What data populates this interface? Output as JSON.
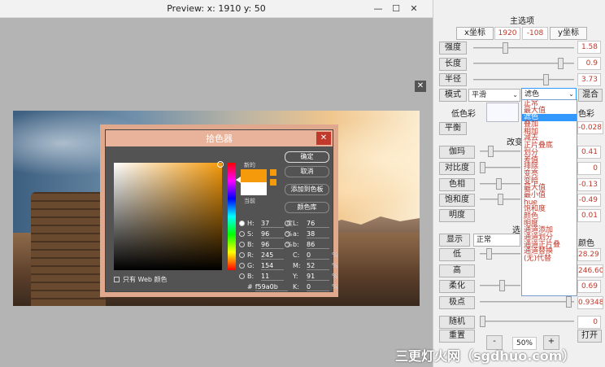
{
  "preview": {
    "title": "Preview:  x: 1910 y: 50",
    "minimize": "—",
    "maximize": "☐",
    "close": "✕",
    "image_close": "✕"
  },
  "picker": {
    "title": "拾色器",
    "close": "✕",
    "new_label": "新的",
    "current_label": "当前",
    "btn_ok": "确定",
    "btn_cancel": "取消",
    "btn_add_swatch": "添加到色板",
    "btn_library": "颜色库",
    "H": "37",
    "H_unit": "度",
    "S": "96",
    "S_unit": "%",
    "Bv": "96",
    "B_unit": "%",
    "R": "245",
    "G": "154",
    "Bc": "11",
    "L": "76",
    "a": "38",
    "b": "86",
    "C": "0",
    "M": "52",
    "Y": "91",
    "K": "0",
    "hex_label": "#",
    "hex": "f59a0b",
    "web_only": "只有 Web 颜色"
  },
  "panel": {
    "title": "主选项",
    "x_tab": "x坐标",
    "x_val": "1920",
    "neg_val": "-108",
    "y_tab": "y坐标",
    "strength_label": "强度",
    "strength_val": "1.58",
    "length_label": "长度",
    "length_val": "0.9",
    "radius_label": "半径",
    "radius_val": "3.73",
    "mode_label": "模式",
    "mode_val": "平滑",
    "filter_val": "滤色",
    "blend_btn": "混合",
    "lowcolor_label": "低色彩",
    "lowcolor_right": "色彩",
    "balance_label": "平衡",
    "balance_val": "-0.0287",
    "change_header": "改变",
    "gamma_label": "伽玛",
    "gamma_val": "0.41",
    "contrast_label": "对比度",
    "contrast_val": "0",
    "hue_label": "色相",
    "hue_val": "-0.13",
    "saturation_label": "饱和度",
    "saturation_val": "-0.49",
    "brightness_label": "明度",
    "brightness_val": "0.01",
    "select_header": "选",
    "display_label": "显示",
    "display_val": "正常",
    "display_right": "颜色",
    "low_label": "低",
    "low_val": "28.29",
    "high_label": "高",
    "high_val": "246.60",
    "soft_label": "柔化",
    "soft_val": "0.69",
    "pole_label": "极点",
    "pole_val": "0.9348",
    "random_label": "随机",
    "random_val": "0",
    "reset_label": "重置",
    "minus": "-",
    "zoom": "50%",
    "plus": "+",
    "open_label": "打开"
  },
  "dropdown_items": [
    "正常",
    "最大值",
    "滤色",
    "叠加",
    "相加",
    "减去",
    "正片叠底",
    "划分",
    "差值",
    "排除",
    "变亮",
    "变暗",
    "最大值",
    "最小值",
    "hue",
    "饱和度",
    "颜色",
    "明度",
    "通道添加",
    "通道划分",
    "通道正片叠",
    "通道替换",
    "(无)代替"
  ],
  "watermark": "三更灯火网（sgdhuo.com）"
}
